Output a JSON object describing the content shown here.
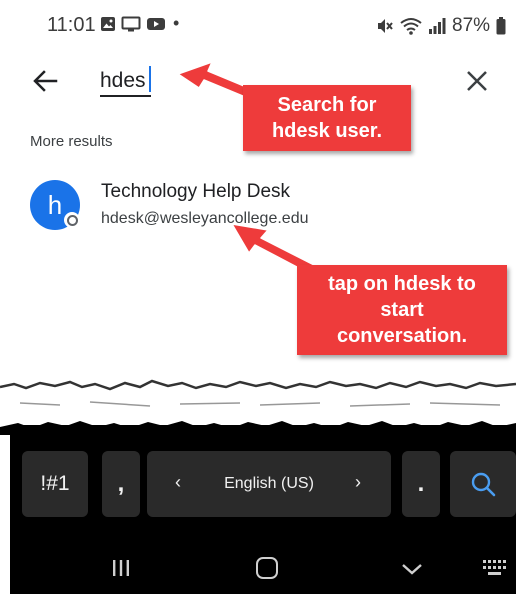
{
  "status_bar": {
    "time": "11:01",
    "dot": "•",
    "battery": "87%"
  },
  "search": {
    "query": "hdes",
    "placeholder": ""
  },
  "results": {
    "section_label": "More results",
    "items": [
      {
        "avatar_letter": "h",
        "name": "Technology Help Desk",
        "email": "hdesk@wesleyancollege.edu"
      }
    ]
  },
  "annotations": {
    "callout_search_line1": "Search for",
    "callout_search_line2": "hdesk user.",
    "callout_tap_line1": "tap on hdesk to",
    "callout_tap_line2": "start",
    "callout_tap_line3": "conversation."
  },
  "keyboard": {
    "symbols_label": "!#1",
    "comma_label": ",",
    "language_label": "English (US)",
    "left_chevron": "‹",
    "right_chevron": "›",
    "period_label": "."
  },
  "colors": {
    "accent": "#1a73e8",
    "callout": "#ee3b3b",
    "keyboard_bg": "#000000",
    "key_bg": "#2a2a2a"
  }
}
